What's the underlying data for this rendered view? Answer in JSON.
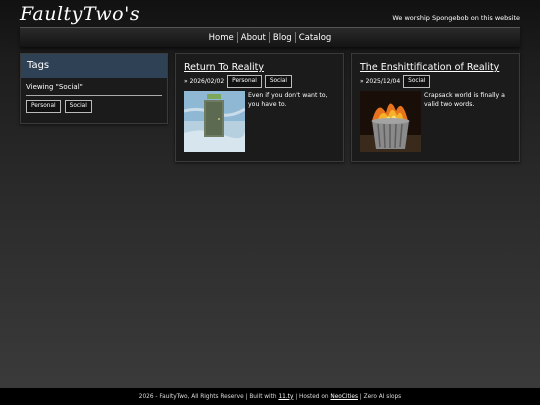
{
  "header": {
    "logo": "FaultyTwo's",
    "tagline": "We worship Spongebob on this website"
  },
  "nav": {
    "items": [
      "Home",
      "About",
      "Blog",
      "Catalog"
    ]
  },
  "tags_panel": {
    "title": "Tags",
    "viewing": "Viewing \"Social\"",
    "tags": [
      "Personal",
      "Social"
    ]
  },
  "posts": [
    {
      "title": "Return To Reality",
      "date": "» 2026/02/02",
      "tags": [
        "Personal",
        "Social"
      ],
      "excerpt": "Even if you don't want to, you have to.",
      "image": "door-in-sky-image"
    },
    {
      "title": "The Enshittification of Reality",
      "date": "» 2025/12/04",
      "tags": [
        "Social"
      ],
      "excerpt": "Crapsack world is finally a valid two words.",
      "image": "burning-trash-can-image"
    }
  ],
  "footer": {
    "copyright": "2026 - FaultyTwo, All Rights Reserve | Built with ",
    "built_with": "11.ty",
    "hosted_text": " | Hosted on ",
    "host": "NeoCities",
    "tail": " | Zero AI slops"
  }
}
